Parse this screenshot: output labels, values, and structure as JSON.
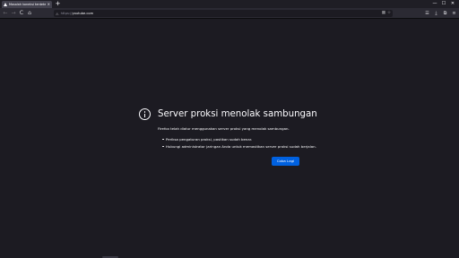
{
  "tab": {
    "title": "Masalah koneksi terdeteksi",
    "close": "×"
  },
  "newtab": {
    "label": "+"
  },
  "window_controls": {
    "minimize": "—",
    "maximize": "☐",
    "close": "✕"
  },
  "nav": {
    "back": "←",
    "forward": "→",
    "reload": "C",
    "home": "⌂"
  },
  "urlbar": {
    "icon": "⚠",
    "prefix": "https://",
    "host": "youtube.com",
    "actions": [
      "▦",
      "☆"
    ]
  },
  "toolbar": {
    "icons": [
      "☰",
      "⤓",
      "⧉",
      "≡"
    ]
  },
  "error": {
    "title": "Server proksi menolak sambungan",
    "description": "Firefox telah diatur menggunakan server proksi yang menolak sambungan.",
    "items": [
      "Periksa pengaturan proksi, pastikan sudah benar.",
      "Hubungi administrator jaringan Anda untuk memastikan server proksi sudah berjalan."
    ],
    "retry_label": "Coba Lagi"
  }
}
